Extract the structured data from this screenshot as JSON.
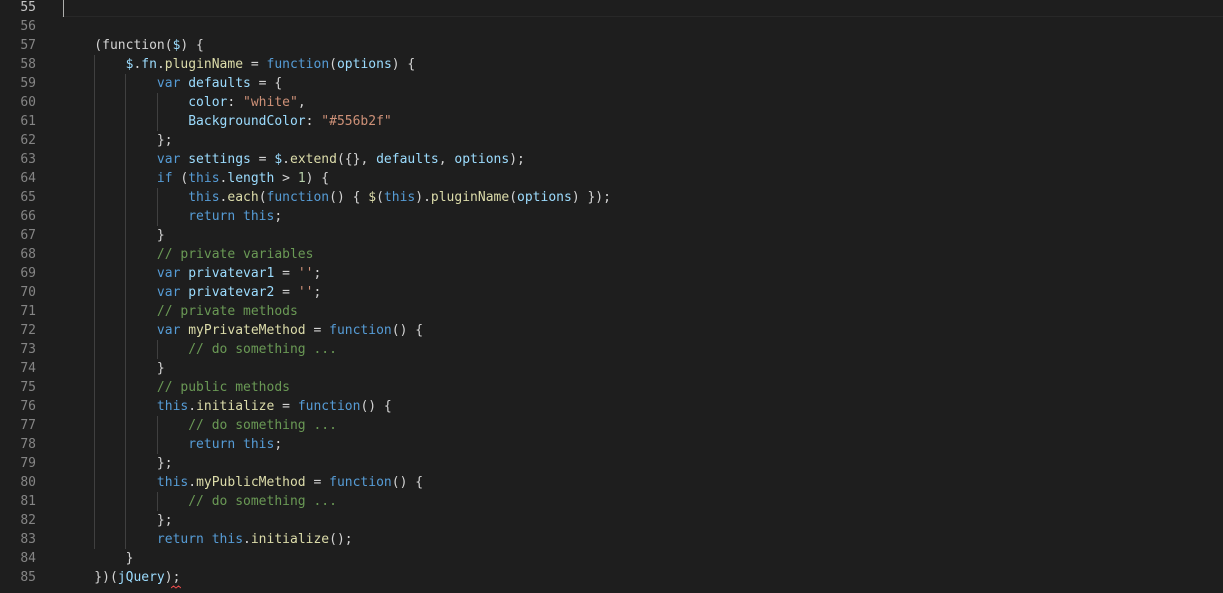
{
  "editor": {
    "theme_colors": {
      "background": "#1e1e1e",
      "line_number": "#858585",
      "keyword": "#569cd6",
      "variable": "#9cdcfe",
      "function": "#dcdcaa",
      "string": "#ce9178",
      "number": "#b5cea8",
      "comment": "#6a9955",
      "punctuation": "#d4d4d4"
    },
    "active_line": 55,
    "lines": [
      {
        "n": "55",
        "tokens": []
      },
      {
        "n": "56",
        "tokens": []
      },
      {
        "n": "57",
        "tokens": [
          [
            "pn",
            "    (function("
          ],
          [
            "var",
            "$"
          ],
          [
            "pn",
            ") {"
          ]
        ]
      },
      {
        "n": "58",
        "tokens": [
          [
            "pn",
            "        "
          ],
          [
            "var",
            "$"
          ],
          [
            "pn",
            "."
          ],
          [
            "var",
            "fn"
          ],
          [
            "pn",
            "."
          ],
          [
            "fn",
            "pluginName"
          ],
          [
            "pn",
            " = "
          ],
          [
            "kw",
            "function"
          ],
          [
            "pn",
            "("
          ],
          [
            "var",
            "options"
          ],
          [
            "pn",
            ") {"
          ]
        ]
      },
      {
        "n": "59",
        "tokens": [
          [
            "pn",
            "            "
          ],
          [
            "kw",
            "var"
          ],
          [
            "pn",
            " "
          ],
          [
            "var",
            "defaults"
          ],
          [
            "pn",
            " = {"
          ]
        ]
      },
      {
        "n": "60",
        "tokens": [
          [
            "pn",
            "                "
          ],
          [
            "var",
            "color"
          ],
          [
            "pn",
            ": "
          ],
          [
            "str",
            "\"white\""
          ],
          [
            "pn",
            ","
          ]
        ]
      },
      {
        "n": "61",
        "tokens": [
          [
            "pn",
            "                "
          ],
          [
            "var",
            "BackgroundColor"
          ],
          [
            "pn",
            ": "
          ],
          [
            "str",
            "\"#556b2f\""
          ]
        ]
      },
      {
        "n": "62",
        "tokens": [
          [
            "pn",
            "            };"
          ]
        ]
      },
      {
        "n": "63",
        "tokens": [
          [
            "pn",
            "            "
          ],
          [
            "kw",
            "var"
          ],
          [
            "pn",
            " "
          ],
          [
            "var",
            "settings"
          ],
          [
            "pn",
            " = "
          ],
          [
            "var",
            "$"
          ],
          [
            "pn",
            "."
          ],
          [
            "fn",
            "extend"
          ],
          [
            "pn",
            "({}, "
          ],
          [
            "var",
            "defaults"
          ],
          [
            "pn",
            ", "
          ],
          [
            "var",
            "options"
          ],
          [
            "pn",
            ");"
          ]
        ]
      },
      {
        "n": "64",
        "tokens": [
          [
            "pn",
            "            "
          ],
          [
            "kw",
            "if"
          ],
          [
            "pn",
            " ("
          ],
          [
            "kw",
            "this"
          ],
          [
            "pn",
            "."
          ],
          [
            "var",
            "length"
          ],
          [
            "pn",
            " > "
          ],
          [
            "num",
            "1"
          ],
          [
            "pn",
            ") {"
          ]
        ]
      },
      {
        "n": "65",
        "tokens": [
          [
            "pn",
            "                "
          ],
          [
            "kw",
            "this"
          ],
          [
            "pn",
            "."
          ],
          [
            "fn",
            "each"
          ],
          [
            "pn",
            "("
          ],
          [
            "kw",
            "function"
          ],
          [
            "pn",
            "() { "
          ],
          [
            "fn",
            "$"
          ],
          [
            "pn",
            "("
          ],
          [
            "kw",
            "this"
          ],
          [
            "pn",
            ")."
          ],
          [
            "fn",
            "pluginName"
          ],
          [
            "pn",
            "("
          ],
          [
            "var",
            "options"
          ],
          [
            "pn",
            ") });"
          ]
        ]
      },
      {
        "n": "66",
        "tokens": [
          [
            "pn",
            "                "
          ],
          [
            "kw",
            "return"
          ],
          [
            "pn",
            " "
          ],
          [
            "kw",
            "this"
          ],
          [
            "pn",
            ";"
          ]
        ]
      },
      {
        "n": "67",
        "tokens": [
          [
            "pn",
            "            }"
          ]
        ]
      },
      {
        "n": "68",
        "tokens": [
          [
            "pn",
            "            "
          ],
          [
            "cm",
            "// private variables"
          ]
        ]
      },
      {
        "n": "69",
        "tokens": [
          [
            "pn",
            "            "
          ],
          [
            "kw",
            "var"
          ],
          [
            "pn",
            " "
          ],
          [
            "var",
            "privatevar1"
          ],
          [
            "pn",
            " = "
          ],
          [
            "str",
            "''"
          ],
          [
            "pn",
            ";"
          ]
        ]
      },
      {
        "n": "70",
        "tokens": [
          [
            "pn",
            "            "
          ],
          [
            "kw",
            "var"
          ],
          [
            "pn",
            " "
          ],
          [
            "var",
            "privatevar2"
          ],
          [
            "pn",
            " = "
          ],
          [
            "str",
            "''"
          ],
          [
            "pn",
            ";"
          ]
        ]
      },
      {
        "n": "71",
        "tokens": [
          [
            "pn",
            "            "
          ],
          [
            "cm",
            "// private methods"
          ]
        ]
      },
      {
        "n": "72",
        "tokens": [
          [
            "pn",
            "            "
          ],
          [
            "kw",
            "var"
          ],
          [
            "pn",
            " "
          ],
          [
            "fn",
            "myPrivateMethod"
          ],
          [
            "pn",
            " = "
          ],
          [
            "kw",
            "function"
          ],
          [
            "pn",
            "() {"
          ]
        ]
      },
      {
        "n": "73",
        "tokens": [
          [
            "pn",
            "                "
          ],
          [
            "cm",
            "// do something ..."
          ]
        ]
      },
      {
        "n": "74",
        "tokens": [
          [
            "pn",
            "            }"
          ]
        ]
      },
      {
        "n": "75",
        "tokens": [
          [
            "pn",
            "            "
          ],
          [
            "cm",
            "// public methods"
          ]
        ]
      },
      {
        "n": "76",
        "tokens": [
          [
            "pn",
            "            "
          ],
          [
            "kw",
            "this"
          ],
          [
            "pn",
            "."
          ],
          [
            "fn",
            "initialize"
          ],
          [
            "pn",
            " = "
          ],
          [
            "kw",
            "function"
          ],
          [
            "pn",
            "() {"
          ]
        ]
      },
      {
        "n": "77",
        "tokens": [
          [
            "pn",
            "                "
          ],
          [
            "cm",
            "// do something ..."
          ]
        ]
      },
      {
        "n": "78",
        "tokens": [
          [
            "pn",
            "                "
          ],
          [
            "kw",
            "return"
          ],
          [
            "pn",
            " "
          ],
          [
            "kw",
            "this"
          ],
          [
            "pn",
            ";"
          ]
        ]
      },
      {
        "n": "79",
        "tokens": [
          [
            "pn",
            "            };"
          ]
        ]
      },
      {
        "n": "80",
        "tokens": [
          [
            "pn",
            "            "
          ],
          [
            "kw",
            "this"
          ],
          [
            "pn",
            "."
          ],
          [
            "fn",
            "myPublicMethod"
          ],
          [
            "pn",
            " = "
          ],
          [
            "kw",
            "function"
          ],
          [
            "pn",
            "() {"
          ]
        ]
      },
      {
        "n": "81",
        "tokens": [
          [
            "pn",
            "                "
          ],
          [
            "cm",
            "// do something ..."
          ]
        ]
      },
      {
        "n": "82",
        "tokens": [
          [
            "pn",
            "            };"
          ]
        ]
      },
      {
        "n": "83",
        "tokens": [
          [
            "pn",
            "            "
          ],
          [
            "kw",
            "return"
          ],
          [
            "pn",
            " "
          ],
          [
            "kw",
            "this"
          ],
          [
            "pn",
            "."
          ],
          [
            "fn",
            "initialize"
          ],
          [
            "pn",
            "();"
          ]
        ]
      },
      {
        "n": "84",
        "tokens": [
          [
            "pn",
            "        }"
          ]
        ]
      },
      {
        "n": "85",
        "tokens": [
          [
            "pn",
            "    })("
          ],
          [
            "var",
            "jQuery"
          ],
          [
            "pn",
            ");"
          ]
        ]
      }
    ]
  }
}
